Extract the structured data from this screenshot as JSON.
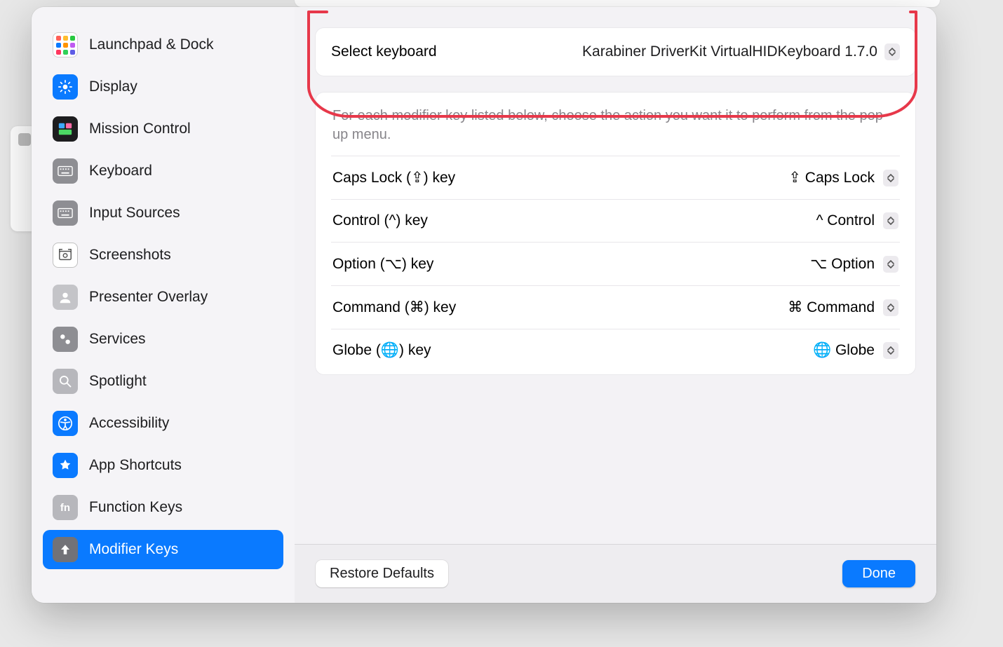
{
  "sidebar": {
    "items": [
      {
        "label": "Launchpad & Dock"
      },
      {
        "label": "Display"
      },
      {
        "label": "Mission Control"
      },
      {
        "label": "Keyboard"
      },
      {
        "label": "Input Sources"
      },
      {
        "label": "Screenshots"
      },
      {
        "label": "Presenter Overlay"
      },
      {
        "label": "Services"
      },
      {
        "label": "Spotlight"
      },
      {
        "label": "Accessibility"
      },
      {
        "label": "App Shortcuts"
      },
      {
        "label": "Function Keys"
      },
      {
        "label": "Modifier Keys"
      }
    ],
    "selected_index": 12
  },
  "keyboard_select": {
    "label": "Select keyboard",
    "value": "Karabiner DriverKit VirtualHIDKeyboard 1.7.0"
  },
  "description": "For each modifier key listed below, choose the action you want it to perform from the pop-up menu.",
  "rows": [
    {
      "label": "Caps Lock (⇪) key",
      "value": "⇪ Caps Lock"
    },
    {
      "label": "Control (^) key",
      "value": "^ Control"
    },
    {
      "label": "Option (⌥) key",
      "value": "⌥ Option"
    },
    {
      "label": "Command (⌘) key",
      "value": "⌘ Command"
    },
    {
      "label": "Globe (🌐) key",
      "value": "🌐 Globe"
    }
  ],
  "footer": {
    "restore": "Restore Defaults",
    "done": "Done"
  }
}
